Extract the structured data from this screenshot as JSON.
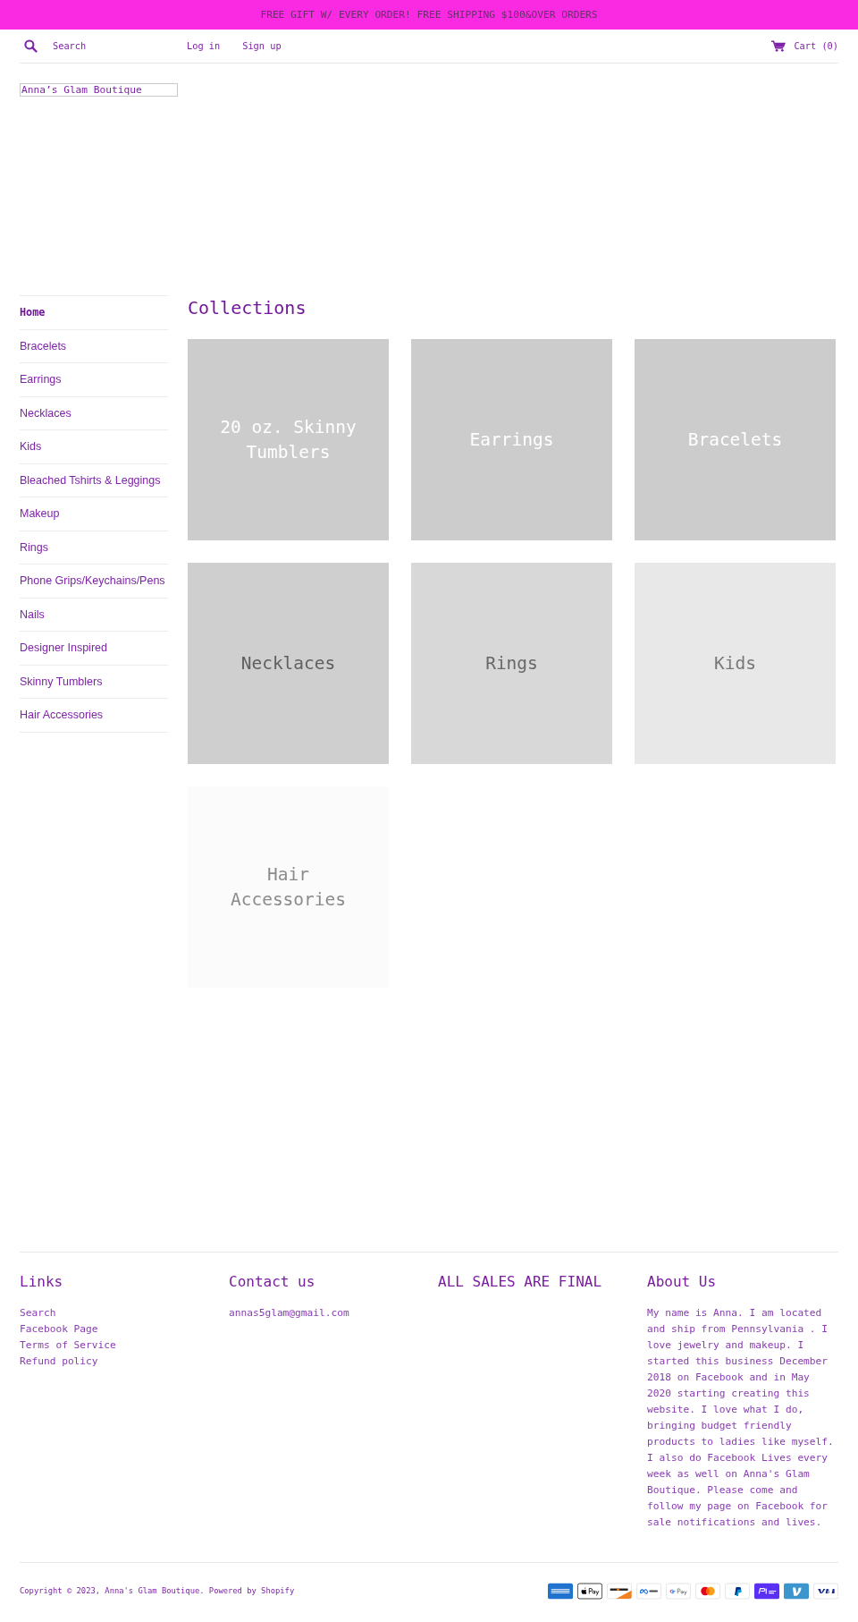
{
  "announcement": {
    "text": "FREE GIFT W/ EVERY ORDER! FREE SHIPPING $100&OVER ORDERS"
  },
  "header": {
    "search": {
      "placeholder": "Search"
    },
    "account_links": [
      "Log in",
      "Sign up"
    ],
    "cart": {
      "label": "Cart (0)"
    }
  },
  "logo": {
    "alt_text": "Anna’s Glam Boutique"
  },
  "sidebar": {
    "items": [
      {
        "label": "Home",
        "selected": true
      },
      {
        "label": "Bracelets",
        "selected": false
      },
      {
        "label": "Earrings",
        "selected": false
      },
      {
        "label": "Necklaces",
        "selected": false
      },
      {
        "label": "Kids",
        "selected": false
      },
      {
        "label": "Bleached Tshirts & Leggings",
        "selected": false
      },
      {
        "label": "Makeup",
        "selected": false
      },
      {
        "label": "Rings",
        "selected": false
      },
      {
        "label": "Phone Grips/Keychains/Pens",
        "selected": false
      },
      {
        "label": "Nails",
        "selected": false
      },
      {
        "label": "Designer Inspired",
        "selected": false
      },
      {
        "label": "Skinny Tumblers",
        "selected": false
      },
      {
        "label": "Hair Accessories",
        "selected": false
      }
    ]
  },
  "collections": {
    "title": "Collections",
    "items": [
      {
        "title": "20 oz. Skinny Tumblers",
        "color": "#cccccc"
      },
      {
        "title": "Earrings",
        "color": "#cccccc"
      },
      {
        "title": "Bracelets",
        "color": "#cccccc"
      },
      {
        "title": "Necklaces",
        "color": "#cfcfcf"
      },
      {
        "title": "Rings",
        "color": "#d8d8d8"
      },
      {
        "title": "Kids",
        "color": "#e8e8e8"
      },
      {
        "title": "Hair Accessories",
        "color": "#fbfbfb"
      }
    ]
  },
  "footer": {
    "columns": [
      {
        "title": "Links",
        "links": [
          "Search",
          "Facebook Page",
          "Terms of Service",
          "Refund policy"
        ]
      },
      {
        "title": "Contact us",
        "text": "annas5glam@gmail.com"
      },
      {
        "title": "ALL SALES ARE FINAL"
      },
      {
        "title": "About Us",
        "text": "My name is Anna. I am located and ship from Pennsylvania . I love jewelry and makeup. I started this business December 2018 on Facebook and in May 2020 starting creating this website. I love what I do, bringing budget friendly products to ladies like myself. I also do Facebook Lives every week as well on Anna's Glam Boutique. Please come and follow my page on Facebook for sale notifications and lives."
      }
    ],
    "copyright": "Copyright © 2023, Anna's Glam Boutique. Powered by Shopify",
    "payment_methods": [
      {
        "kind": "amex"
      },
      {
        "kind": "apple_pay"
      },
      {
        "kind": "discover"
      },
      {
        "kind": "meta_pay"
      },
      {
        "kind": "google_pay"
      },
      {
        "kind": "mastercard"
      },
      {
        "kind": "paypal"
      },
      {
        "kind": "shop_pay"
      },
      {
        "kind": "venmo"
      },
      {
        "kind": "visa"
      }
    ]
  }
}
